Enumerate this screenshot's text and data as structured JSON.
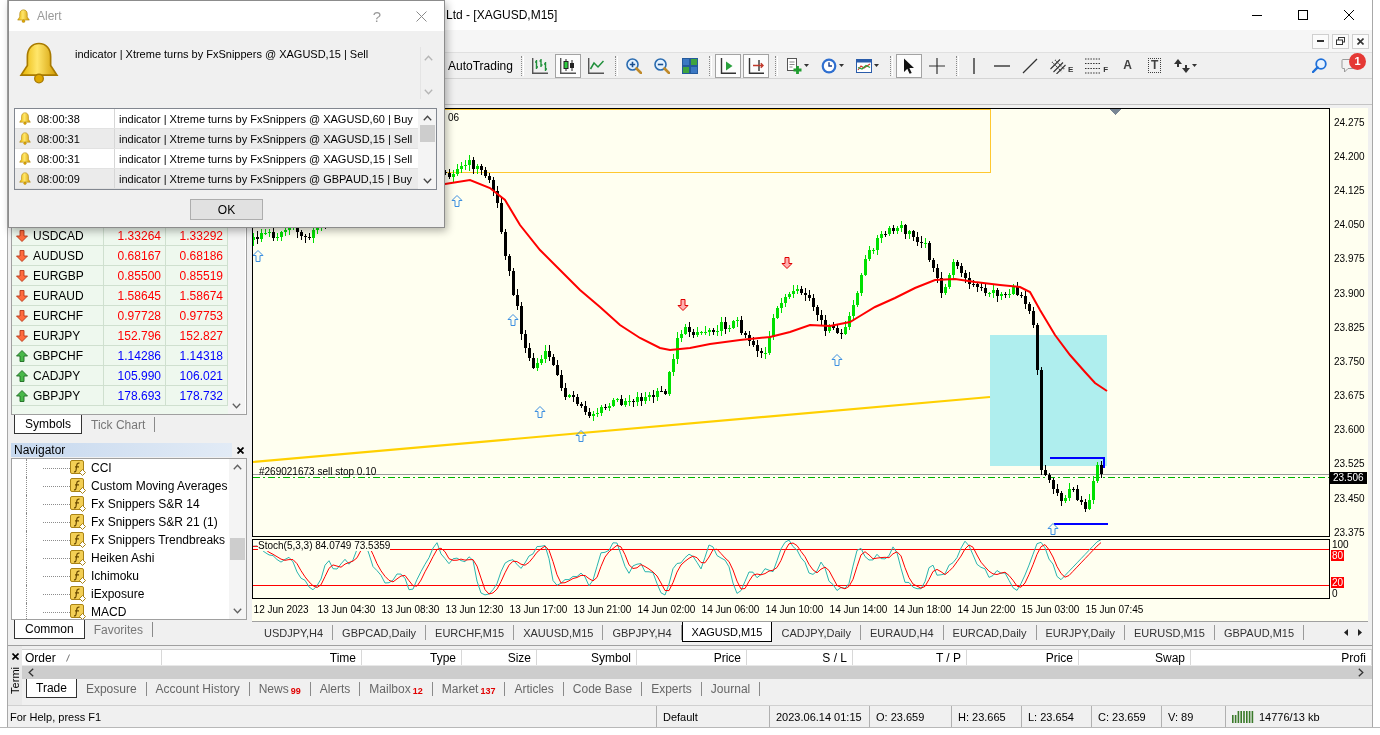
{
  "window": {
    "title": "Ltd - [XAGUSD,M15]"
  },
  "toolbar": {
    "autotrading": "AutoTrading",
    "groups": [
      {
        "buttons": [
          {
            "kind": "bar_chart",
            "pressed": false
          },
          {
            "kind": "candlesticks",
            "pressed": true
          },
          {
            "kind": "line_chart",
            "pressed": false
          }
        ]
      },
      {
        "buttons": [
          {
            "kind": "zoom_in",
            "pressed": false
          },
          {
            "kind": "zoom_out",
            "pressed": false
          },
          {
            "kind": "tile_windows",
            "pressed": false
          }
        ]
      },
      {
        "buttons": [
          {
            "kind": "auto_scroll",
            "pressed": true
          },
          {
            "kind": "chart_shift",
            "pressed": true
          }
        ]
      },
      {
        "buttons": [
          {
            "kind": "indicators",
            "pressed": false
          },
          {
            "kind": "periods",
            "pressed": false
          },
          {
            "kind": "templates",
            "pressed": false
          }
        ]
      },
      {
        "buttons": [
          {
            "kind": "cursor",
            "pressed": true
          },
          {
            "kind": "crosshair",
            "pressed": false
          }
        ]
      },
      {
        "buttons": [
          {
            "kind": "vertical_line",
            "pressed": false
          },
          {
            "kind": "horizontal_line",
            "pressed": false
          },
          {
            "kind": "trend_line",
            "pressed": false
          },
          {
            "kind": "channel",
            "glyph": "E",
            "pressed": false
          },
          {
            "kind": "fibonacci",
            "glyph": "F",
            "pressed": false
          },
          {
            "kind": "text",
            "glyph": "A",
            "pressed": false
          },
          {
            "kind": "label",
            "glyph": "T",
            "pressed": false
          },
          {
            "kind": "arrows",
            "pressed": false
          }
        ]
      }
    ],
    "notifications": {
      "count": "1"
    }
  },
  "alert_dialog": {
    "title": "Alert",
    "help": "?",
    "message": "indicator | Xtreme turns by FxSnippers @ XAGUSD,15 | Sell",
    "history": [
      {
        "time": "08:00:38",
        "message": "indicator | Xtreme turns by FxSnippers @ XAGUSD,60 | Buy"
      },
      {
        "time": "08:00:31",
        "message": "indicator | Xtreme turns by FxSnippers @ XAGUSD,15 | Sell"
      },
      {
        "time": "08:00:31",
        "message": "indicator | Xtreme turns by FxSnippers @ XAGUSD,15 | Sell"
      },
      {
        "time": "08:00:09",
        "message": "indicator | Xtreme turns by FxSnippers @ GBPAUD,15 | Buy"
      }
    ],
    "ok_button": "OK"
  },
  "market_watch": {
    "rows": [
      {
        "symbol": "USDCAD",
        "bid": "1.33264",
        "ask": "1.33292",
        "kind": "down"
      },
      {
        "symbol": "AUDUSD",
        "bid": "0.68167",
        "ask": "0.68186",
        "kind": "down"
      },
      {
        "symbol": "EURGBP",
        "bid": "0.85500",
        "ask": "0.85519",
        "kind": "down"
      },
      {
        "symbol": "EURAUD",
        "bid": "1.58645",
        "ask": "1.58674",
        "kind": "down"
      },
      {
        "symbol": "EURCHF",
        "bid": "0.97728",
        "ask": "0.97753",
        "kind": "down"
      },
      {
        "symbol": "EURJPY",
        "bid": "152.796",
        "ask": "152.827",
        "kind": "down"
      },
      {
        "symbol": "GBPCHF",
        "bid": "1.14286",
        "ask": "1.14318",
        "kind": "up"
      },
      {
        "symbol": "CADJPY",
        "bid": "105.990",
        "ask": "106.021",
        "kind": "up"
      },
      {
        "symbol": "GBPJPY",
        "bid": "178.693",
        "ask": "178.732",
        "kind": "up"
      }
    ],
    "tabs": [
      {
        "label": "Symbols",
        "selected": true
      },
      {
        "label": "Tick Chart",
        "selected": false
      }
    ]
  },
  "navigator": {
    "title": "Navigator",
    "items": [
      "CCI",
      "Custom Moving Averages",
      "Fx Snippers S&R 14",
      "Fx Snippers S&R 21 (1)",
      "Fx Snippers Trendbreaks",
      "Heiken Ashi",
      "Ichimoku",
      "iExposure",
      "MACD"
    ],
    "tabs": [
      {
        "label": "Common",
        "selected": true
      },
      {
        "label": "Favorites",
        "selected": false
      }
    ]
  },
  "chart": {
    "comment": "06",
    "price_axis": [
      "24.275",
      "24.200",
      "24.125",
      "24.050",
      "23.975",
      "23.900",
      "23.825",
      "23.750",
      "23.675",
      "23.600",
      "23.525",
      "23.450",
      "23.375"
    ],
    "current_price": "23.506",
    "order_label": "#269021673 sell stop 0.10",
    "indicator": {
      "label": "Stoch(5,3,3) 84.0749 73.5359",
      "axis": [
        {
          "label": "100",
          "kind": "plain"
        },
        {
          "label": "80",
          "kind": "level"
        },
        {
          "label": "20",
          "kind": "level"
        },
        {
          "label": "0",
          "kind": "plain"
        }
      ]
    },
    "time_axis": [
      "12 Jun 2023",
      "13 Jun 04:30",
      "13 Jun 08:30",
      "13 Jun 12:30",
      "13 Jun 17:00",
      "13 Jun 21:00",
      "14 Jun 02:00",
      "14 Jun 06:00",
      "14 Jun 10:00",
      "14 Jun 14:00",
      "14 Jun 18:00",
      "14 Jun 22:00",
      "15 Jun 03:00",
      "15 Jun 07:45"
    ]
  },
  "chart_tabs": [
    {
      "label": "USDJPY,H4",
      "selected": false
    },
    {
      "label": "GBPCAD,Daily",
      "selected": false
    },
    {
      "label": "EURCHF,M15",
      "selected": false
    },
    {
      "label": "XAUUSD,M15",
      "selected": false
    },
    {
      "label": "GBPJPY,H4",
      "selected": false
    },
    {
      "label": "XAGUSD,M15",
      "selected": true
    },
    {
      "label": "CADJPY,Daily",
      "selected": false
    },
    {
      "label": "EURAUD,H4",
      "selected": false
    },
    {
      "label": "EURCAD,Daily",
      "selected": false
    },
    {
      "label": "EURJPY,Daily",
      "selected": false
    },
    {
      "label": "EURUSD,M15",
      "selected": false
    },
    {
      "label": "GBPAUD,M15",
      "selected": false
    }
  ],
  "terminal": {
    "title": "Termi",
    "columns": [
      "Order",
      "Time",
      "Type",
      "Size",
      "Symbol",
      "Price",
      "S / L",
      "T / P",
      "Price",
      "Swap",
      "Profi"
    ],
    "tabs": [
      {
        "label": "Trade",
        "selected": true
      },
      {
        "label": "Exposure",
        "selected": false
      },
      {
        "label": "Account History",
        "selected": false
      },
      {
        "label": "News",
        "badge": "99",
        "selected": false
      },
      {
        "label": "Alerts",
        "selected": false
      },
      {
        "label": "Mailbox",
        "badge": "12",
        "selected": false
      },
      {
        "label": "Market",
        "badge": "137",
        "selected": false
      },
      {
        "label": "Articles",
        "selected": false
      },
      {
        "label": "Code Base",
        "selected": false
      },
      {
        "label": "Experts",
        "selected": false
      },
      {
        "label": "Journal",
        "selected": false
      }
    ]
  },
  "status_bar": {
    "help": "For Help, press F1",
    "profile": "Default",
    "datetime": "2023.06.14 01:15",
    "open": "O: 23.659",
    "high": "H: 23.665",
    "low": "L: 23.654",
    "close": "C: 23.659",
    "volume": "V: 89",
    "traffic": "14776/13 kb"
  }
}
